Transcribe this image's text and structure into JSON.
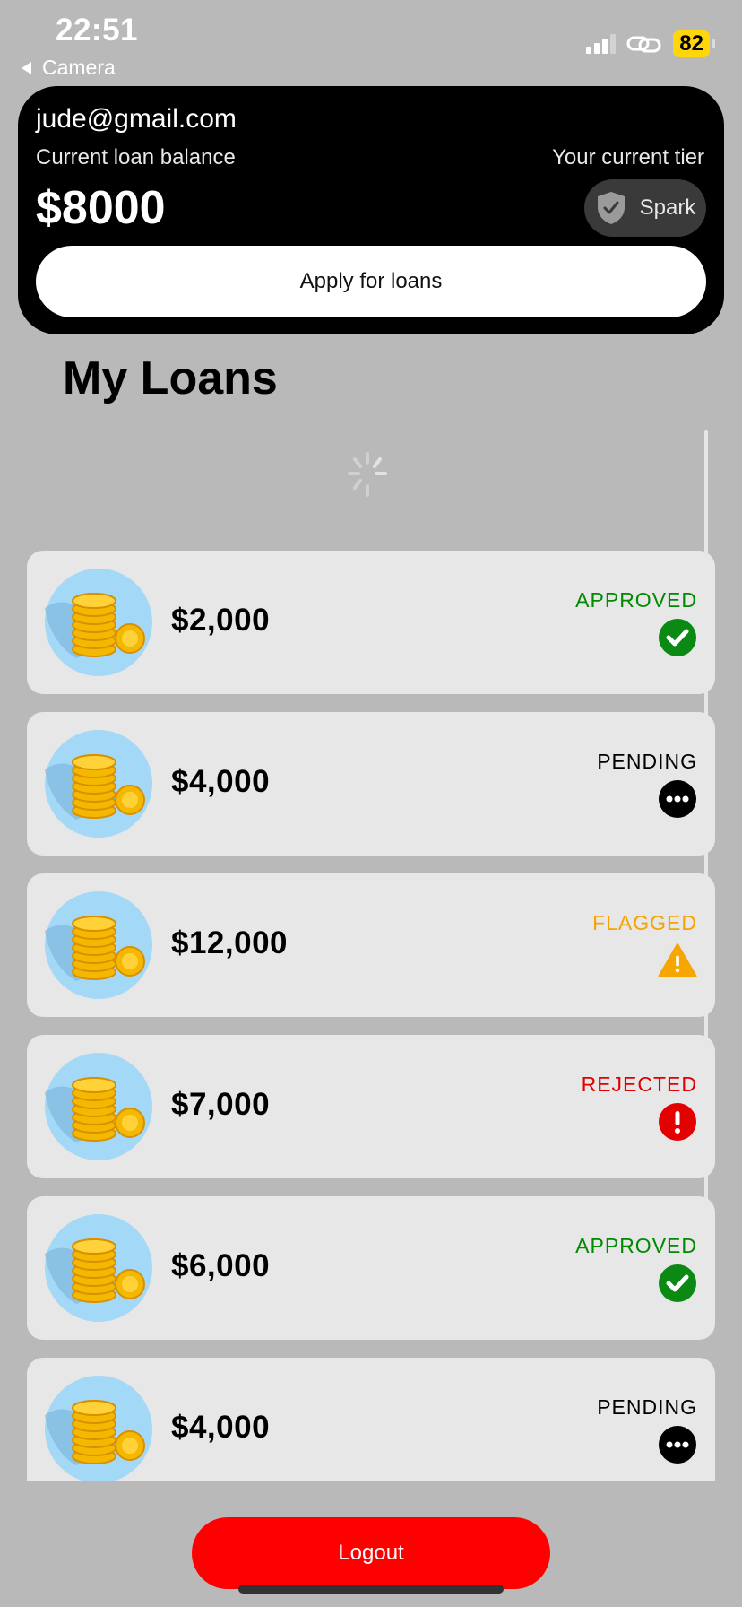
{
  "status_bar": {
    "time": "22:51",
    "back_label": "Camera",
    "battery": "82"
  },
  "header": {
    "email": "jude@gmail.com",
    "balance_label": "Current loan balance",
    "balance": "$8000",
    "tier_label": "Your current tier",
    "tier_name": "Spark",
    "apply_label": "Apply for loans"
  },
  "page_title": "My Loans",
  "loans": [
    {
      "amount": "$2,000",
      "status": "APPROVED",
      "status_color": "#008a00",
      "icon": "check-circle-icon"
    },
    {
      "amount": "$4,000",
      "status": "PENDING",
      "status_color": "#000000",
      "icon": "more-dots-icon"
    },
    {
      "amount": "$12,000",
      "status": "FLAGGED",
      "status_color": "#f5a300",
      "icon": "warning-triangle-icon"
    },
    {
      "amount": "$7,000",
      "status": "REJECTED",
      "status_color": "#e00000",
      "icon": "alert-circle-icon"
    },
    {
      "amount": "$6,000",
      "status": "APPROVED",
      "status_color": "#008a00",
      "icon": "check-circle-icon"
    },
    {
      "amount": "$4,000",
      "status": "PENDING",
      "status_color": "#000000",
      "icon": "more-dots-icon"
    }
  ],
  "logout_label": "Logout",
  "colors": {
    "background": "#b9b9b9",
    "header": "#000000",
    "logout": "#ff0000",
    "card": "#e7e7e7"
  }
}
